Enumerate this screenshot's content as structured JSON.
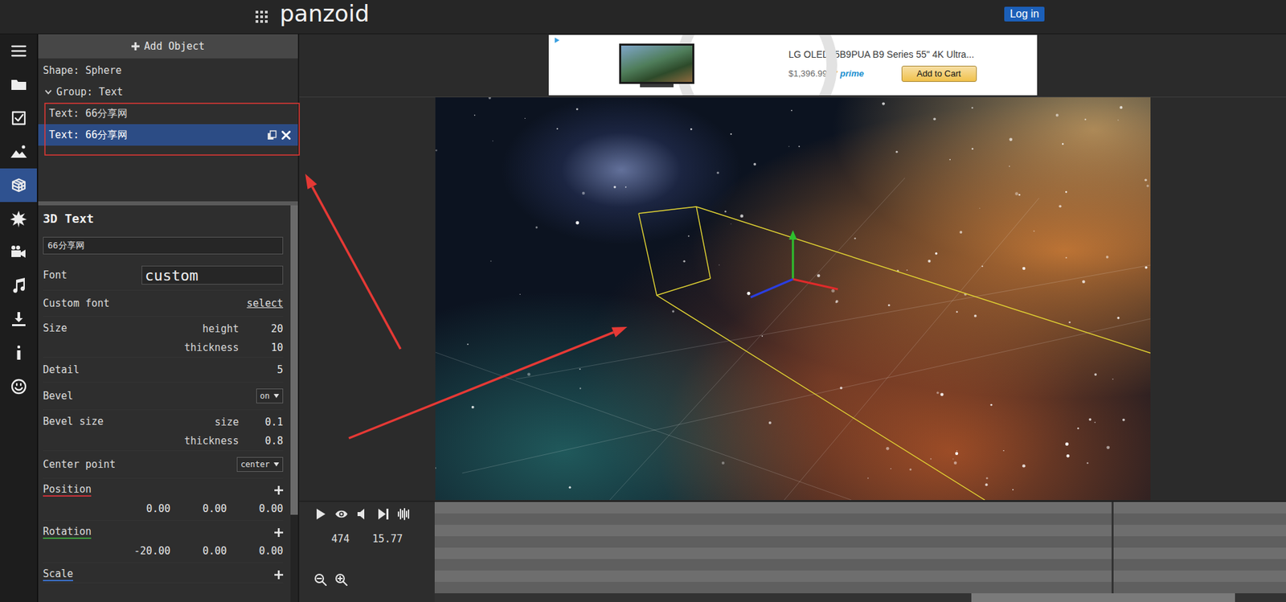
{
  "topbar": {
    "logo": "panzoid",
    "login": "Log in"
  },
  "sidebar": [
    {
      "selected": false
    },
    {
      "selected": false
    },
    {
      "selected": false
    },
    {
      "selected": false
    },
    {
      "selected": true
    },
    {
      "selected": false
    },
    {
      "selected": false
    },
    {
      "selected": false
    },
    {
      "selected": false
    },
    {
      "selected": false
    },
    {
      "selected": false
    }
  ],
  "objects": {
    "add": "Add Object",
    "items": [
      {
        "kind": "shape",
        "label": "Shape: Sphere",
        "expanded": false,
        "selected": false
      },
      {
        "kind": "group",
        "label": "Group: Text",
        "expanded": true,
        "selected": false
      },
      {
        "kind": "child",
        "label": "Text: 66分享网",
        "expanded": false,
        "selected": false
      },
      {
        "kind": "child",
        "label": "Text: 66分享网",
        "expanded": false,
        "selected": true
      }
    ]
  },
  "properties": {
    "title": "3D Text",
    "text": "66分享网",
    "scrollbar": {
      "level": 0.78
    },
    "rows": [
      {
        "kind": "field",
        "label": "Font",
        "value": "custom"
      },
      {
        "kind": "link",
        "label": "Custom font",
        "value": "select"
      },
      {
        "kind": "pair",
        "label": "Size",
        "items": [
          {
            "name": "height",
            "value": "20"
          },
          {
            "name": "thickness",
            "value": "10"
          }
        ]
      },
      {
        "kind": "number",
        "label": "Detail",
        "value": "5"
      },
      {
        "kind": "select",
        "label": "Bevel",
        "value": "on"
      },
      {
        "kind": "pair",
        "label": "Bevel size",
        "items": [
          {
            "name": "size",
            "value": "0.1"
          },
          {
            "name": "thickness",
            "value": "0.8"
          }
        ]
      },
      {
        "kind": "select",
        "label": "Center point",
        "value": "center"
      },
      {
        "kind": "vector",
        "label": "Position",
        "color": "#c8323a",
        "values": [
          "0.00",
          "0.00",
          "0.00"
        ]
      },
      {
        "kind": "vector",
        "label": "Rotation",
        "color": "#3c9a3c",
        "values": [
          "-20.00",
          "0.00",
          "0.00"
        ]
      },
      {
        "kind": "vector",
        "label": "Scale",
        "color": "#3a6fc8",
        "values": []
      }
    ]
  },
  "ad": {
    "title": "LG OLED55B9PUA B9 Series 55\" 4K Ultra...",
    "price": "$1,396.99",
    "prime": "prime",
    "button": "Add to Cart"
  },
  "timeline": {
    "frame": "474",
    "time": "15.77",
    "scrollbar": {
      "level": 0.31
    }
  }
}
